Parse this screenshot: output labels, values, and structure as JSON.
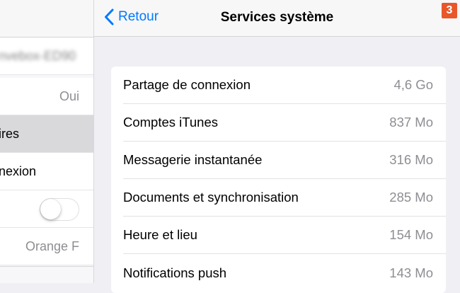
{
  "left_pane": {
    "rows": [
      {
        "text": "nvebox-ED90",
        "kind": "blurred"
      },
      {
        "text": "Oui",
        "kind": "value"
      },
      {
        "text": "ires",
        "kind": "selected"
      },
      {
        "text": "nexion",
        "kind": "label"
      },
      {
        "kind": "toggle",
        "state": "off"
      },
      {
        "text": "Orange F",
        "kind": "value"
      }
    ]
  },
  "navbar": {
    "back_label": "Retour",
    "title": "Services système",
    "badge": "3"
  },
  "list": {
    "items": [
      {
        "label": "Partage de connexion",
        "value": "4,6 Go"
      },
      {
        "label": "Comptes iTunes",
        "value": "837 Mo"
      },
      {
        "label": "Messagerie instantanée",
        "value": "316 Mo"
      },
      {
        "label": "Documents et synchronisation",
        "value": "285 Mo"
      },
      {
        "label": "Heure et lieu",
        "value": "154 Mo"
      },
      {
        "label": "Notifications push",
        "value": "143 Mo"
      }
    ]
  },
  "colors": {
    "accent": "#007aff",
    "badge": "#e8562a",
    "background": "#efeff4",
    "secondary_text": "#8e8e93"
  },
  "icons": {
    "back": "chevron-left-icon"
  }
}
